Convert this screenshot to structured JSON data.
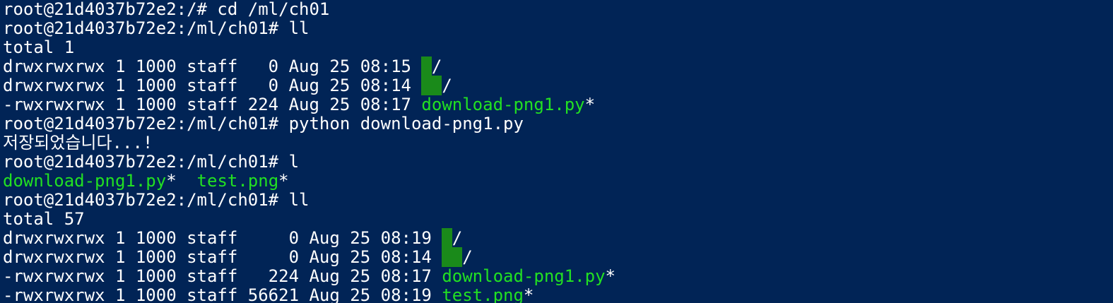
{
  "colors": {
    "background": "#012456",
    "text": "#ffffff",
    "executable": "#22e022",
    "dir_highlight": "#1a8a1a"
  },
  "lines": [
    {
      "segments": [
        {
          "text": "root@21d4037b72e2:/# cd /ml/ch01",
          "style": "plain"
        }
      ]
    },
    {
      "segments": [
        {
          "text": "root@21d4037b72e2:/ml/ch01# ll",
          "style": "plain"
        }
      ]
    },
    {
      "segments": [
        {
          "text": "total 1",
          "style": "plain"
        }
      ]
    },
    {
      "segments": [
        {
          "text": "drwxrwxrwx 1 1000 staff   0 Aug 25 08:15 ",
          "style": "plain"
        },
        {
          "text": ".",
          "style": "hl"
        },
        {
          "text": "/",
          "style": "plain"
        }
      ]
    },
    {
      "segments": [
        {
          "text": "drwxrwxrwx 1 1000 staff   0 Aug 25 08:14 ",
          "style": "plain"
        },
        {
          "text": "..",
          "style": "hl"
        },
        {
          "text": "/",
          "style": "plain"
        }
      ]
    },
    {
      "segments": [
        {
          "text": "-rwxrwxrwx 1 1000 staff 224 Aug 25 08:17 ",
          "style": "plain"
        },
        {
          "text": "download-png1.py",
          "style": "green"
        },
        {
          "text": "*",
          "style": "plain"
        }
      ]
    },
    {
      "segments": [
        {
          "text": "root@21d4037b72e2:/ml/ch01# python download-png1.py",
          "style": "plain"
        }
      ]
    },
    {
      "segments": [
        {
          "text": "저장되었습니다...!",
          "style": "plain"
        }
      ]
    },
    {
      "segments": [
        {
          "text": "root@21d4037b72e2:/ml/ch01# l",
          "style": "plain"
        }
      ]
    },
    {
      "segments": [
        {
          "text": "download-png1.py",
          "style": "green"
        },
        {
          "text": "*  ",
          "style": "plain"
        },
        {
          "text": "test.png",
          "style": "green"
        },
        {
          "text": "*",
          "style": "plain"
        }
      ]
    },
    {
      "segments": [
        {
          "text": "root@21d4037b72e2:/ml/ch01# ll",
          "style": "plain"
        }
      ]
    },
    {
      "segments": [
        {
          "text": "total 57",
          "style": "plain"
        }
      ]
    },
    {
      "segments": [
        {
          "text": "drwxrwxrwx 1 1000 staff     0 Aug 25 08:19 ",
          "style": "plain"
        },
        {
          "text": ".",
          "style": "hl"
        },
        {
          "text": "/",
          "style": "plain"
        }
      ]
    },
    {
      "segments": [
        {
          "text": "drwxrwxrwx 1 1000 staff     0 Aug 25 08:14 ",
          "style": "plain"
        },
        {
          "text": "..",
          "style": "hl"
        },
        {
          "text": "/",
          "style": "plain"
        }
      ]
    },
    {
      "segments": [
        {
          "text": "-rwxrwxrwx 1 1000 staff   224 Aug 25 08:17 ",
          "style": "plain"
        },
        {
          "text": "download-png1.py",
          "style": "green"
        },
        {
          "text": "*",
          "style": "plain"
        }
      ]
    },
    {
      "segments": [
        {
          "text": "-rwxrwxrwx 1 1000 staff 56621 Aug 25 08:19 ",
          "style": "plain"
        },
        {
          "text": "test.png",
          "style": "green"
        },
        {
          "text": "*",
          "style": "plain"
        }
      ]
    }
  ]
}
